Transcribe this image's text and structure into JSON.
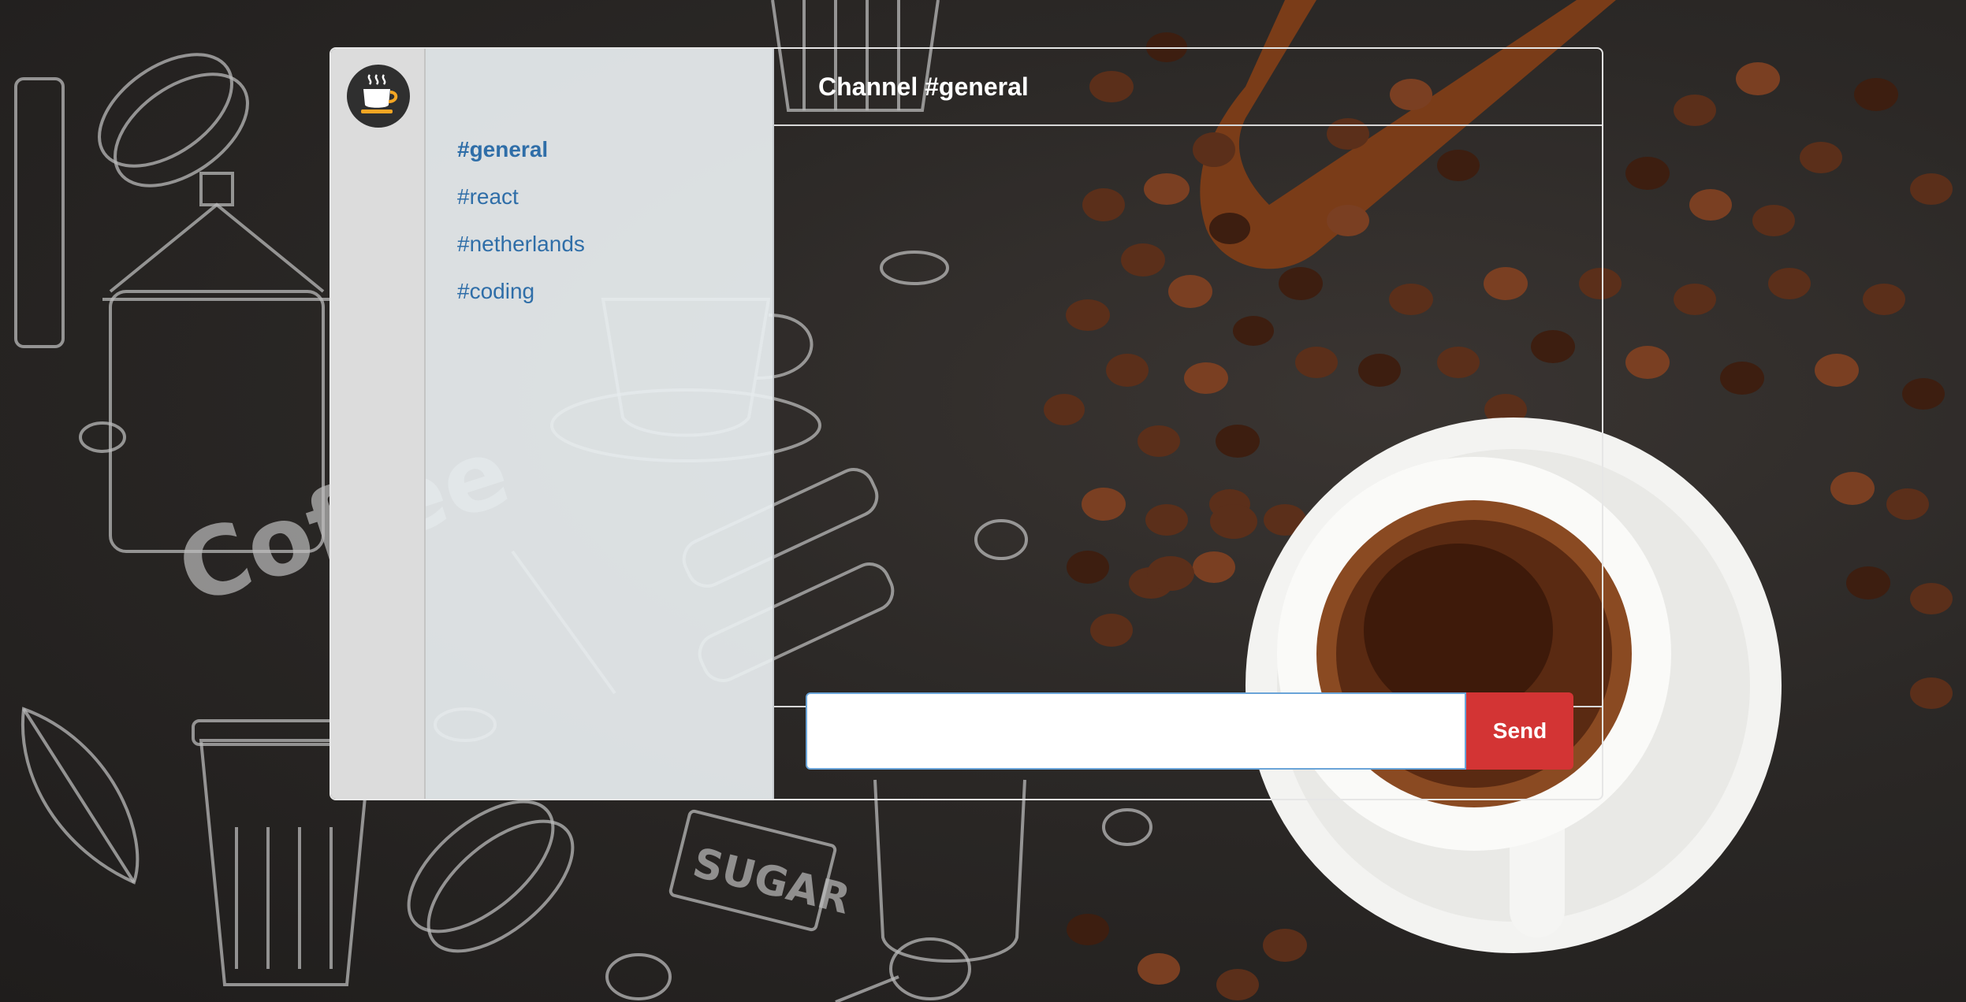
{
  "sidebar": {
    "logo_icon": "coffee-cup-icon",
    "channels": [
      {
        "label": "#general",
        "active": true
      },
      {
        "label": "#react",
        "active": false
      },
      {
        "label": "#netherlands",
        "active": false
      },
      {
        "label": "#coding",
        "active": false
      }
    ]
  },
  "header": {
    "title": "Channel #general"
  },
  "composer": {
    "input_value": "",
    "send_label": "Send"
  },
  "colors": {
    "channel_link": "#2f6ea8",
    "send_button": "#d33434",
    "logo_cup_saucer": "#f4a623"
  }
}
